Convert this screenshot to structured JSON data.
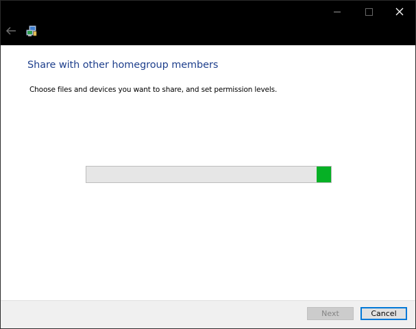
{
  "window": {
    "caption_buttons": {
      "minimize_icon": "minimize-icon",
      "maximize_icon": "maximize-icon",
      "close_icon": "close-icon"
    },
    "back_icon": "back-arrow-icon",
    "app_icon": "homegroup-icon"
  },
  "main": {
    "heading": "Share with other homegroup members",
    "instruction": "Choose files and devices you want to share, and set permission levels.",
    "progress": {
      "indeterminate": true,
      "segment_start_fraction": 0.94,
      "segment_end_fraction": 1.0,
      "color": "#06b025"
    }
  },
  "footer": {
    "next_label": "Next",
    "next_enabled": false,
    "cancel_label": "Cancel"
  },
  "colors": {
    "titlebar": "#000000",
    "heading": "#1e3f8c",
    "focus_border": "#0078d7"
  }
}
